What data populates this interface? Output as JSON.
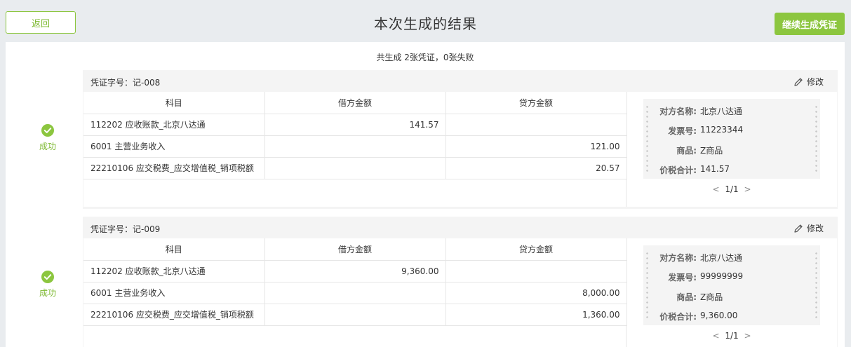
{
  "header": {
    "back_label": "返回",
    "title": "本次生成的结果",
    "continue_label": "继续生成凭证"
  },
  "summary": "共生成 2张凭证，0张失败",
  "colors": {
    "accent": "#8cc63f"
  },
  "vouchers": [
    {
      "status_icon": "check-circle-icon",
      "status": "成功",
      "voucher_no": "凭证字号：记-008",
      "edit_label": "修改",
      "columns": [
        "科目",
        "借方金额",
        "贷方金额"
      ],
      "rows": [
        {
          "subject": "112202 应收账款_北京八达通",
          "debit": "141.57",
          "credit": ""
        },
        {
          "subject": "6001 主营业务收入",
          "debit": "",
          "credit": "121.00"
        },
        {
          "subject": "22210106 应交税费_应交增值税_销项税额",
          "debit": "",
          "credit": "20.57"
        }
      ],
      "invoice": {
        "counterparty_label": "对方名称:",
        "counterparty": "北京八达通",
        "invoice_no_label": "发票号:",
        "invoice_no": "11223344",
        "goods_label": "商品:",
        "goods": "Z商品",
        "total_label": "价税合计:",
        "total": "141.57"
      },
      "pager": "1/1"
    },
    {
      "status_icon": "check-circle-icon",
      "status": "成功",
      "voucher_no": "凭证字号：记-009",
      "edit_label": "修改",
      "columns": [
        "科目",
        "借方金额",
        "贷方金额"
      ],
      "rows": [
        {
          "subject": "112202 应收账款_北京八达通",
          "debit": "9,360.00",
          "credit": ""
        },
        {
          "subject": "6001 主营业务收入",
          "debit": "",
          "credit": "8,000.00"
        },
        {
          "subject": "22210106 应交税费_应交增值税_销项税额",
          "debit": "",
          "credit": "1,360.00"
        }
      ],
      "invoice": {
        "counterparty_label": "对方名称:",
        "counterparty": "北京八达通",
        "invoice_no_label": "发票号:",
        "invoice_no": "99999999",
        "goods_label": "商品:",
        "goods": "Z商品",
        "total_label": "价税合计:",
        "total": "9,360.00"
      },
      "pager": "1/1"
    }
  ]
}
